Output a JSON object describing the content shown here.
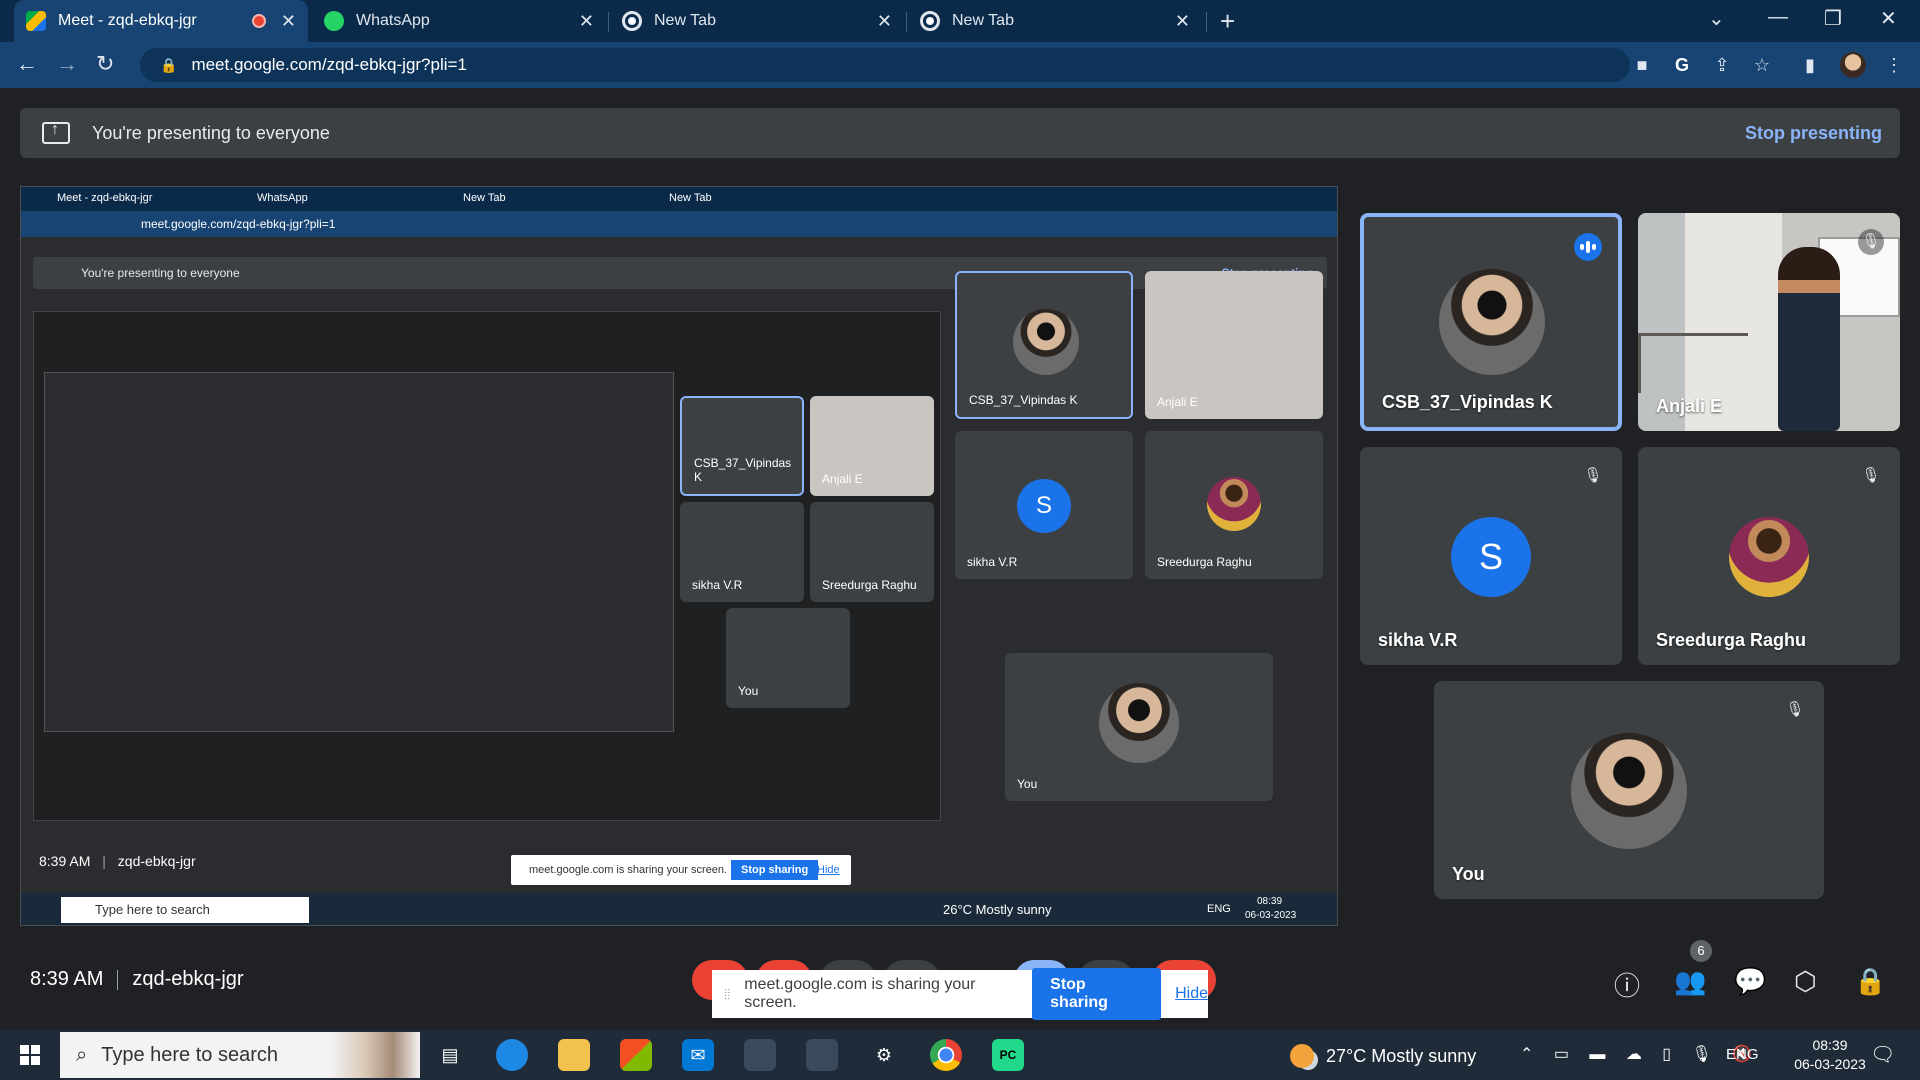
{
  "browser": {
    "tabs": [
      {
        "title": "Meet - zqd-ebkq-jgr",
        "active": true,
        "icon": "meet-icon",
        "recording": true
      },
      {
        "title": "WhatsApp",
        "active": false,
        "icon": "whatsapp-icon"
      },
      {
        "title": "New Tab",
        "active": false,
        "icon": "chrome-icon"
      },
      {
        "title": "New Tab",
        "active": false,
        "icon": "chrome-icon"
      }
    ],
    "new_tab_symbol": "+",
    "url": "meet.google.com/zqd-ebkq-jgr?pli=1"
  },
  "presenting_bar": {
    "message": "You're presenting to everyone",
    "stop_label": "Stop presenting"
  },
  "shared_screen": {
    "tabs": [
      "Meet - zqd-ebkq-jgr",
      "WhatsApp",
      "New Tab",
      "New Tab"
    ],
    "url": "meet.google.com/zqd-ebkq-jgr?pli=1",
    "presenting_message": "You're presenting to everyone",
    "stop_label": "Stop presenting",
    "tiles": [
      "CSB_37_Vipindas K",
      "Anjali E",
      "sikha V.R",
      "Sreedurga Raghu",
      "You"
    ],
    "clock": "8:39 AM",
    "meeting_code": "zqd-ebkq-jgr",
    "notice_text": "meet.google.com is sharing your screen.",
    "notice_button": "Stop sharing",
    "notice_hide": "Hide",
    "taskbar_search": "Type here to search",
    "weather": "26°C Mostly sunny",
    "lang": "ENG",
    "time": "08:39",
    "date": "06-03-2023"
  },
  "participants": [
    {
      "name": "CSB_37_Vipindas K",
      "speaking": true,
      "avatar": "photo"
    },
    {
      "name": "Anjali E",
      "speaking": false,
      "avatar": "video",
      "muted": true
    },
    {
      "name": "sikha V.R",
      "speaking": false,
      "avatar": "letter",
      "letter": "S",
      "muted": true
    },
    {
      "name": "Sreedurga Raghu",
      "speaking": false,
      "avatar": "photo",
      "muted": true
    },
    {
      "name": "You",
      "speaking": false,
      "avatar": "photo",
      "muted": true
    }
  ],
  "meeting": {
    "clock": "8:39 AM",
    "code": "zqd-ebkq-jgr",
    "participant_count": "6"
  },
  "sharing_notice": {
    "text": "meet.google.com is sharing your screen.",
    "stop_label": "Stop sharing",
    "hide_label": "Hide"
  },
  "taskbar": {
    "search_placeholder": "Type here to search",
    "weather": "27°C  Mostly sunny",
    "lang": "ENG",
    "time": "08:39",
    "date": "06-03-2023"
  },
  "colors": {
    "accent": "#8ab4f8",
    "meet_blue": "#1a73e8",
    "end_call_red": "#ea4335",
    "tab_bar": "#0b2a4a",
    "toolbar": "#174473"
  }
}
